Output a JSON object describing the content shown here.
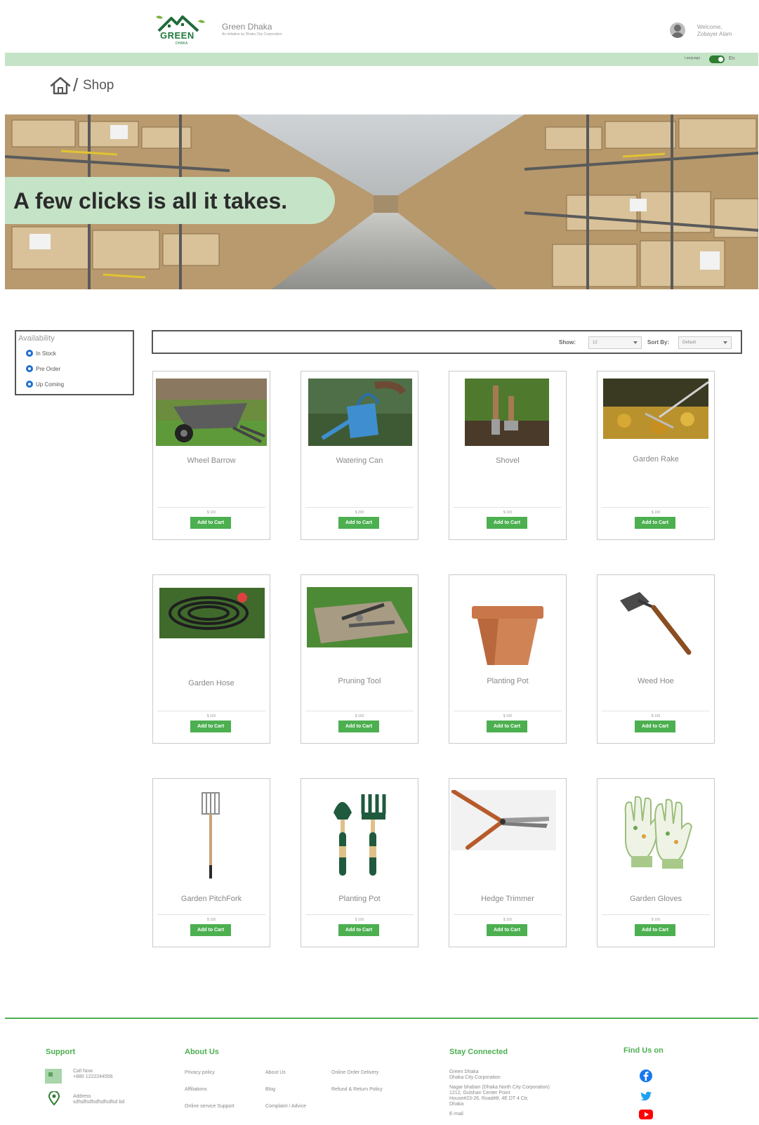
{
  "header": {
    "logo_text": "GREEN",
    "logo_sub": "DHAKA",
    "brand_name": "Green Dhaka",
    "brand_tagline": "An initiative by Dhaka City Corporation",
    "welcome_line1": "Welcome,",
    "welcome_line2": "Zobayer Alam",
    "language_label": "Language",
    "language_current": "En"
  },
  "breadcrumb": {
    "current": "Shop",
    "separator": "/"
  },
  "hero": {
    "headline": "A few clicks is all it takes."
  },
  "filter": {
    "title": "Availability",
    "options": [
      {
        "label": "In Stock",
        "checked": true
      },
      {
        "label": "Pre Order",
        "checked": true
      },
      {
        "label": "Up Coming",
        "checked": true
      }
    ]
  },
  "toolbar": {
    "show_label": "Show:",
    "show_value": "12",
    "sort_label": "Sort By:",
    "sort_value": "Default"
  },
  "products": [
    {
      "name": "Wheel Barrow",
      "price": "$ 100",
      "button": "Add to Cart"
    },
    {
      "name": "Watering Can",
      "price": "$ 200",
      "button": "Add to Cart"
    },
    {
      "name": "Shovel",
      "price": "$ 100",
      "button": "Add to Cart"
    },
    {
      "name": "Garden Rake",
      "price": "$ 100",
      "button": "Add to Cart"
    },
    {
      "name": "Garden Hose",
      "price": "$ 100",
      "button": "Add to Cart"
    },
    {
      "name": "Pruning Tool",
      "price": "$ 100",
      "button": "Add to Cart"
    },
    {
      "name": "Planting Pot",
      "price": "$ 100",
      "button": "Add to Cart"
    },
    {
      "name": "Weed Hoe",
      "price": "$ 100",
      "button": "Add to Cart"
    },
    {
      "name": "Garden PitchFork",
      "price": "$ 100",
      "button": "Add to Cart"
    },
    {
      "name": "Planting Pot",
      "price": "$ 100",
      "button": "Add to Cart"
    },
    {
      "name": "Hedge Trimmer",
      "price": "$ 100",
      "button": "Add to Cart"
    },
    {
      "name": "Garden Gloves",
      "price": "$ 100",
      "button": "Add to Cart"
    }
  ],
  "footer": {
    "support": {
      "title": "Support",
      "call_label": "Call Now",
      "call_number": "+880 1222244556",
      "address_label": "Address",
      "address_value": "sdfsdfsdfsdfsdfsdfsd bd"
    },
    "about": {
      "title": "About Us",
      "links": [
        "Privacy policy",
        "About Us",
        "Online Order Delivery",
        "Affiliations",
        "Blog",
        "Refund & Return Policy",
        "Online service Support",
        "Complaint / Advice"
      ]
    },
    "stay_connected": {
      "title": "Stay Connected",
      "line1": "Green Dhaka",
      "line2": "Dhaka City Corporation",
      "line3": "Nagar bhaban (Dhaka North City Corporation)",
      "line4": "1212, Gulshan Center Point",
      "line5": "House#23-26, Road#8, 4E DT 4 Ctr,",
      "line6": "Dhaka",
      "line7": "E-mail"
    },
    "find_us": {
      "title": "Find Us on"
    }
  },
  "colors": {
    "accent_green": "#4caf50",
    "light_green": "#c5e3c7",
    "dark_green": "#1f7a3a",
    "radio_blue": "#1e6fd0"
  }
}
